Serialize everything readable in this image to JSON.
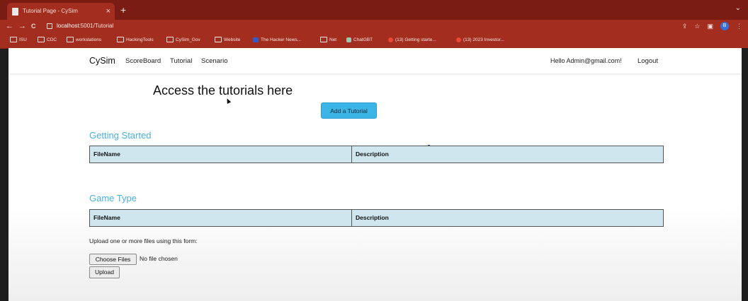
{
  "browser": {
    "tab_title": "Tutorial Page - CySim",
    "close_glyph": "×",
    "new_tab_glyph": "+",
    "window_controls": "⌄",
    "url_host": "localhost",
    "url_path": ":5001/Tutorial",
    "back_glyph": "←",
    "forward_glyph": "→",
    "reload_glyph": "C",
    "profile_initial": "B",
    "bookmarks": [
      {
        "label": "ISU"
      },
      {
        "label": "CDC"
      },
      {
        "label": "workstations"
      },
      {
        "label": "HackingTools"
      },
      {
        "label": "CySim_Gov"
      },
      {
        "label": "Website"
      },
      {
        "label": "The Hacker News..."
      },
      {
        "label": "Net"
      },
      {
        "label": "ChatGBT"
      },
      {
        "label": "(13) Getting starte..."
      },
      {
        "label": "(13) 2023 Investor..."
      }
    ]
  },
  "nav": {
    "brand": "CySim",
    "links": [
      "ScoreBoard",
      "Tutorial",
      "Scenario"
    ],
    "greeting": "Hello Admin@gmail.com!",
    "logout": "Logout"
  },
  "main": {
    "heading": "Access the tutorials here",
    "add_button": "Add a Tutorial",
    "sections": [
      {
        "title": "Getting Started",
        "columns": [
          "FileName",
          "Description"
        ]
      },
      {
        "title": "Game Type",
        "columns": [
          "FileName",
          "Description"
        ]
      }
    ],
    "upload": {
      "label": "Upload one or more files using this form:",
      "choose_button": "Choose Files",
      "no_file": "No file chosen",
      "upload_button": "Upload"
    }
  },
  "colors": {
    "browser_chrome": "#a32d1e",
    "accent": "#3db4e6",
    "section_title": "#4bb0dc",
    "table_header": "#cfe6ef"
  }
}
